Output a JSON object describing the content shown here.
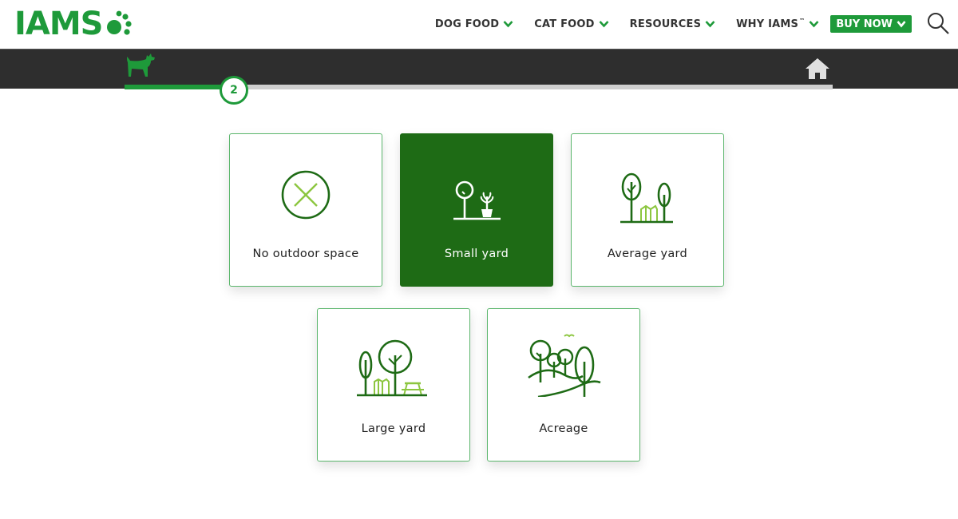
{
  "header": {
    "logo_text": "IAMS",
    "logo_icon": "paw-icon",
    "nav": [
      {
        "label": "DOG FOOD",
        "sup": ""
      },
      {
        "label": "CAT FOOD",
        "sup": ""
      },
      {
        "label": "RESOURCES",
        "sup": ""
      },
      {
        "label": "WHY IAMS",
        "sup": "™"
      }
    ],
    "buy_now_label": "BUY NOW",
    "search_icon": "search-icon"
  },
  "progress": {
    "current_step": "2",
    "fraction_complete": 0.15,
    "start_icon": "dog-icon",
    "end_icon": "home-icon"
  },
  "options": [
    {
      "label": "No outdoor space",
      "icon": "no-outdoor-icon",
      "selected": false
    },
    {
      "label": "Small yard",
      "icon": "small-yard-icon",
      "selected": true
    },
    {
      "label": "Average yard",
      "icon": "average-yard-icon",
      "selected": false
    },
    {
      "label": "Large yard",
      "icon": "large-yard-icon",
      "selected": false
    },
    {
      "label": "Acreage",
      "icon": "acreage-icon",
      "selected": false
    }
  ],
  "colors": {
    "brand_green": "#1e9a3a",
    "selected_green": "#1e6b15",
    "icon_dark_green": "#1e6b15",
    "icon_light_green": "#8cc63f",
    "bar_dark": "#2e2e2e"
  }
}
